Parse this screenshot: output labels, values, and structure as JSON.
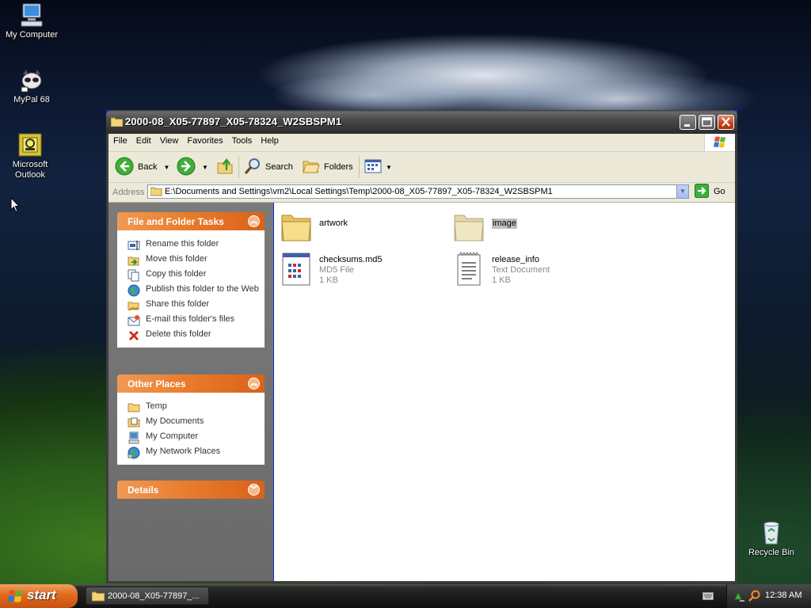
{
  "desktop": {
    "icons": [
      {
        "label": "My Computer",
        "icon": "computer-icon"
      },
      {
        "label": "MyPal 68",
        "icon": "mypal-icon"
      },
      {
        "label": "Microsoft Outlook",
        "icon": "outlook-icon"
      },
      {
        "label": "Recycle Bin",
        "icon": "recycle-bin-icon"
      }
    ]
  },
  "window": {
    "title": "2000-08_X05-77897_X05-78324_W2SBSPM1",
    "menu": [
      "File",
      "Edit",
      "View",
      "Favorites",
      "Tools",
      "Help"
    ],
    "toolbar": {
      "back": "Back",
      "search": "Search",
      "folders": "Folders"
    },
    "address": {
      "label": "Address",
      "path": "E:\\Documents and Settings\\vm2\\Local Settings\\Temp\\2000-08_X05-77897_X05-78324_W2SBSPM1",
      "go": "Go"
    },
    "tasks_panel": {
      "title": "File and Folder Tasks",
      "items": [
        {
          "label": "Rename this folder",
          "icon": "rename-icon"
        },
        {
          "label": "Move this folder",
          "icon": "move-icon"
        },
        {
          "label": "Copy this folder",
          "icon": "copy-icon"
        },
        {
          "label": "Publish this folder to the Web",
          "icon": "publish-web-icon"
        },
        {
          "label": "Share this folder",
          "icon": "share-icon"
        },
        {
          "label": "E-mail this folder's files",
          "icon": "email-icon"
        },
        {
          "label": "Delete this folder",
          "icon": "delete-icon"
        }
      ]
    },
    "places_panel": {
      "title": "Other Places",
      "items": [
        {
          "label": "Temp",
          "icon": "folder-icon"
        },
        {
          "label": "My Documents",
          "icon": "my-documents-icon"
        },
        {
          "label": "My Computer",
          "icon": "computer-icon"
        },
        {
          "label": "My Network Places",
          "icon": "network-icon"
        }
      ]
    },
    "details_panel": {
      "title": "Details"
    },
    "files": [
      {
        "name": "artwork",
        "type": "",
        "size": "",
        "icon": "folder-icon",
        "selected": false
      },
      {
        "name": "image",
        "type": "",
        "size": "",
        "icon": "folder-icon",
        "selected": true
      },
      {
        "name": "checksums.md5",
        "type": "MD5 File",
        "size": "1 KB",
        "icon": "md5-file-icon",
        "selected": false
      },
      {
        "name": "release_info",
        "type": "Text Document",
        "size": "1 KB",
        "icon": "text-document-icon",
        "selected": false
      }
    ]
  },
  "taskbar": {
    "start": "start",
    "task_title": "2000-08_X05-77897_...",
    "clock": "12:38 AM"
  },
  "colors": {
    "panel_header": "#e87a2a",
    "title_bar": "#3a3a3a",
    "start_button": "#e06a1e"
  }
}
